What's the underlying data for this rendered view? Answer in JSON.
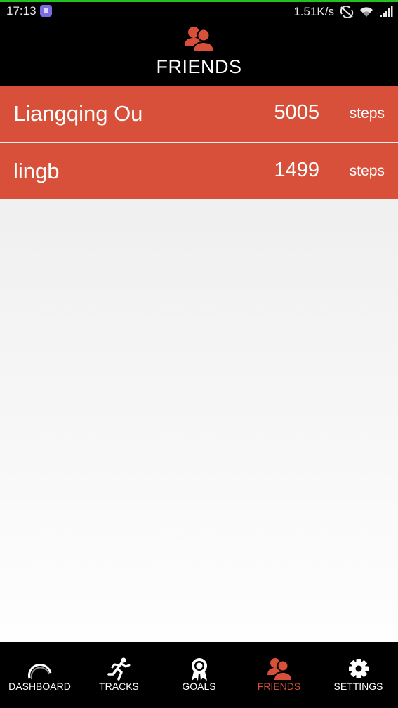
{
  "status_bar": {
    "time": "17:13",
    "network_speed": "1.51K/s",
    "icons": [
      "app-notification-icon",
      "no-sync-icon",
      "wifi-icon",
      "signal-icon"
    ]
  },
  "header": {
    "icon": "friends-icon",
    "title": "FRIENDS"
  },
  "friends": [
    {
      "name": "Liangqing Ou",
      "steps": "5005",
      "unit": "steps"
    },
    {
      "name": "lingb",
      "steps": "1499",
      "unit": "steps"
    }
  ],
  "bottom_nav": {
    "items": [
      {
        "label": "DASHBOARD",
        "icon": "dashboard-gauge-icon"
      },
      {
        "label": "TRACKS",
        "icon": "running-person-icon"
      },
      {
        "label": "GOALS",
        "icon": "award-ribbon-icon"
      },
      {
        "label": "FRIENDS",
        "icon": "friends-icon",
        "active": true
      },
      {
        "label": "SETTINGS",
        "icon": "gear-icon"
      }
    ]
  },
  "colors": {
    "accent": "#d8503a",
    "header_background": "#000000",
    "status_line": "#22c01d"
  }
}
